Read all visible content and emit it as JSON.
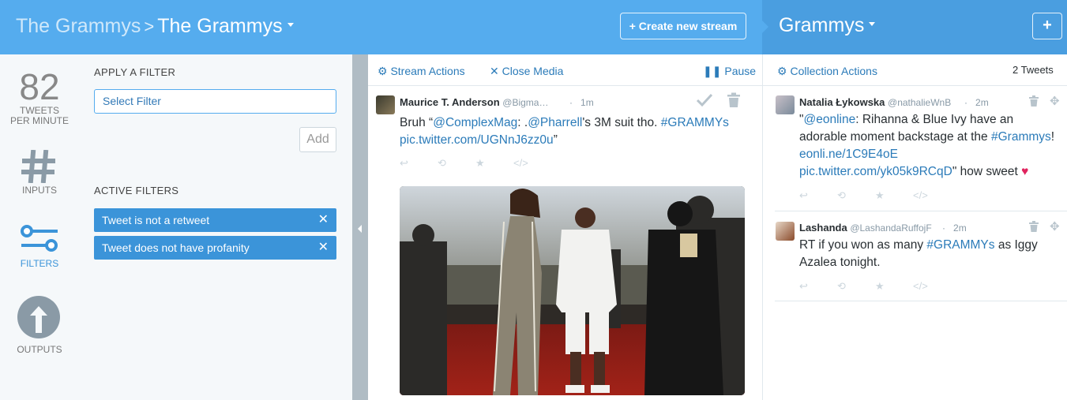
{
  "header": {
    "parent_crumb": "The Grammys",
    "separator": ">",
    "current_crumb": "The Grammys",
    "create_button": "+ Create new stream",
    "collection_title": "Grammys",
    "add_button": "+"
  },
  "rail": {
    "tpm_value": "82",
    "tpm_label_line1": "TWEETS",
    "tpm_label_line2": "PER MINUTE",
    "inputs": "INPUTS",
    "filters": "FILTERS",
    "outputs": "OUTPUTS"
  },
  "filter_panel": {
    "apply_heading": "APPLY A FILTER",
    "select_placeholder": "Select Filter",
    "add_button": "Add",
    "active_heading": "ACTIVE FILTERS",
    "active_filters": [
      "Tweet is not a retweet",
      "Tweet does not have profanity"
    ],
    "remove_glyph": "✕"
  },
  "stream": {
    "toolbar": {
      "actions": "Stream Actions",
      "close_media": "Close Media",
      "pause": "Pause"
    },
    "tweet": {
      "name": "Maurice T. Anderson",
      "handle": "@Bigma…",
      "dot": "·",
      "time": "1m",
      "text_prefix": "Bruh “",
      "mention1": "@ComplexMag",
      "text_mid1": ": .",
      "mention2": "@Pharrell",
      "text_mid2": "'s 3M suit tho. ",
      "hashtag": "#GRAMMYs",
      "link": "pic.twitter.com/UGNnJ6zz0u",
      "text_suffix": "”"
    }
  },
  "collection": {
    "toolbar": {
      "actions": "Collection Actions",
      "count": "2 Tweets"
    },
    "tweets": [
      {
        "name": "Natalia Łykowska",
        "handle": "@nathalieWnB",
        "dot": "·",
        "time": "2m",
        "text_q1": "\"",
        "mention": "@eonline",
        "text_a": ": Rihanna & Blue Ivy have an adorable moment backstage at the ",
        "hashtag": "#Grammys",
        "text_b": "! ",
        "link1": "eonli.ne/1C9E4oE",
        "link2": "pic.twitter.com/yk05k9RCqD",
        "text_c": "\" how sweet ",
        "emoji": "♥"
      },
      {
        "name": "Lashanda",
        "handle": "@LashandaRuffojF",
        "dot": "·",
        "time": "2m",
        "text_a": "RT if you won as many ",
        "hashtag": "#GRAMMYs",
        "text_b": " as Iggy Azalea tonight."
      }
    ]
  },
  "colors": {
    "header": "#55acee",
    "header_right": "#4a9ee0",
    "chip": "#3b94d9",
    "link": "#2b7bb9"
  }
}
